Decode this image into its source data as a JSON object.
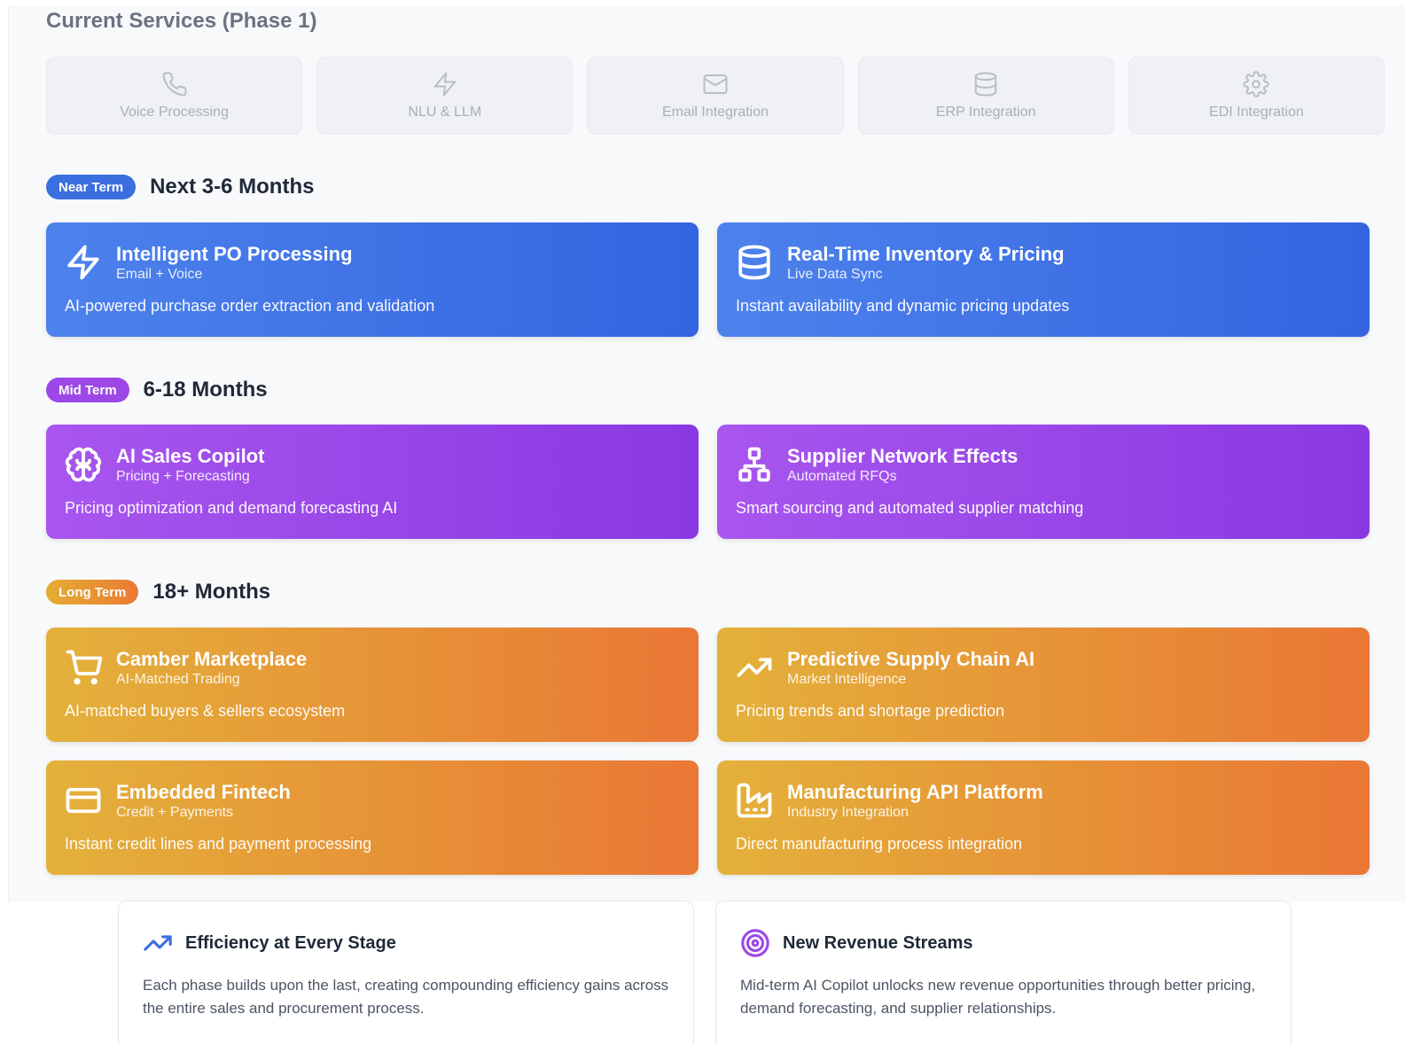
{
  "current": {
    "title": "Current Services (Phase 1)",
    "services": [
      {
        "label": "Voice Processing",
        "icon": "phone-icon"
      },
      {
        "label": "NLU & LLM",
        "icon": "lightning-icon"
      },
      {
        "label": "Email Integration",
        "icon": "mail-icon"
      },
      {
        "label": "ERP Integration",
        "icon": "database-icon"
      },
      {
        "label": "EDI Integration",
        "icon": "gear-icon"
      }
    ]
  },
  "near": {
    "badge": "Near Term",
    "title": "Next 3-6 Months",
    "cards": [
      {
        "title": "Intelligent PO Processing",
        "subtitle": "Email + Voice",
        "description": "AI-powered purchase order extraction and validation",
        "icon": "lightning-icon"
      },
      {
        "title": "Real-Time Inventory & Pricing",
        "subtitle": "Live Data Sync",
        "description": "Instant availability and dynamic pricing updates",
        "icon": "database-icon"
      }
    ]
  },
  "mid": {
    "badge": "Mid Term",
    "title": "6-18 Months",
    "cards": [
      {
        "title": "AI Sales Copilot",
        "subtitle": "Pricing + Forecasting",
        "description": "Pricing optimization and demand forecasting AI",
        "icon": "brain-icon"
      },
      {
        "title": "Supplier Network Effects",
        "subtitle": "Automated RFQs",
        "description": "Smart sourcing and automated supplier matching",
        "icon": "network-icon"
      }
    ]
  },
  "long": {
    "badge": "Long Term",
    "title": "18+ Months",
    "cards": [
      {
        "title": "Camber Marketplace",
        "subtitle": "AI-Matched Trading",
        "description": "AI-matched buyers & sellers ecosystem",
        "icon": "cart-icon"
      },
      {
        "title": "Predictive Supply Chain AI",
        "subtitle": "Market Intelligence",
        "description": "Pricing trends and shortage prediction",
        "icon": "trending-up-icon"
      },
      {
        "title": "Embedded Fintech",
        "subtitle": "Credit + Payments",
        "description": "Instant credit lines and payment processing",
        "icon": "credit-card-icon"
      },
      {
        "title": "Manufacturing API Platform",
        "subtitle": "Industry Integration",
        "description": "Direct manufacturing process integration",
        "icon": "factory-icon"
      }
    ]
  },
  "summary": [
    {
      "title": "Efficiency at Every Stage",
      "text": "Each phase builds upon the last, creating compounding efficiency gains across the entire sales and procurement process.",
      "icon": "trending-up-icon",
      "color": "#3b6fe0"
    },
    {
      "title": "New Revenue Streams",
      "text": "Mid-term AI Copilot unlocks new revenue opportunities through better pricing, demand forecasting, and supplier relationships.",
      "icon": "target-icon",
      "color": "#9d48e6"
    }
  ],
  "colors": {
    "near": "#3b6fe0",
    "mid": "#9d48e6",
    "long_start": "#e3b13a",
    "long_end": "#ea7735"
  }
}
